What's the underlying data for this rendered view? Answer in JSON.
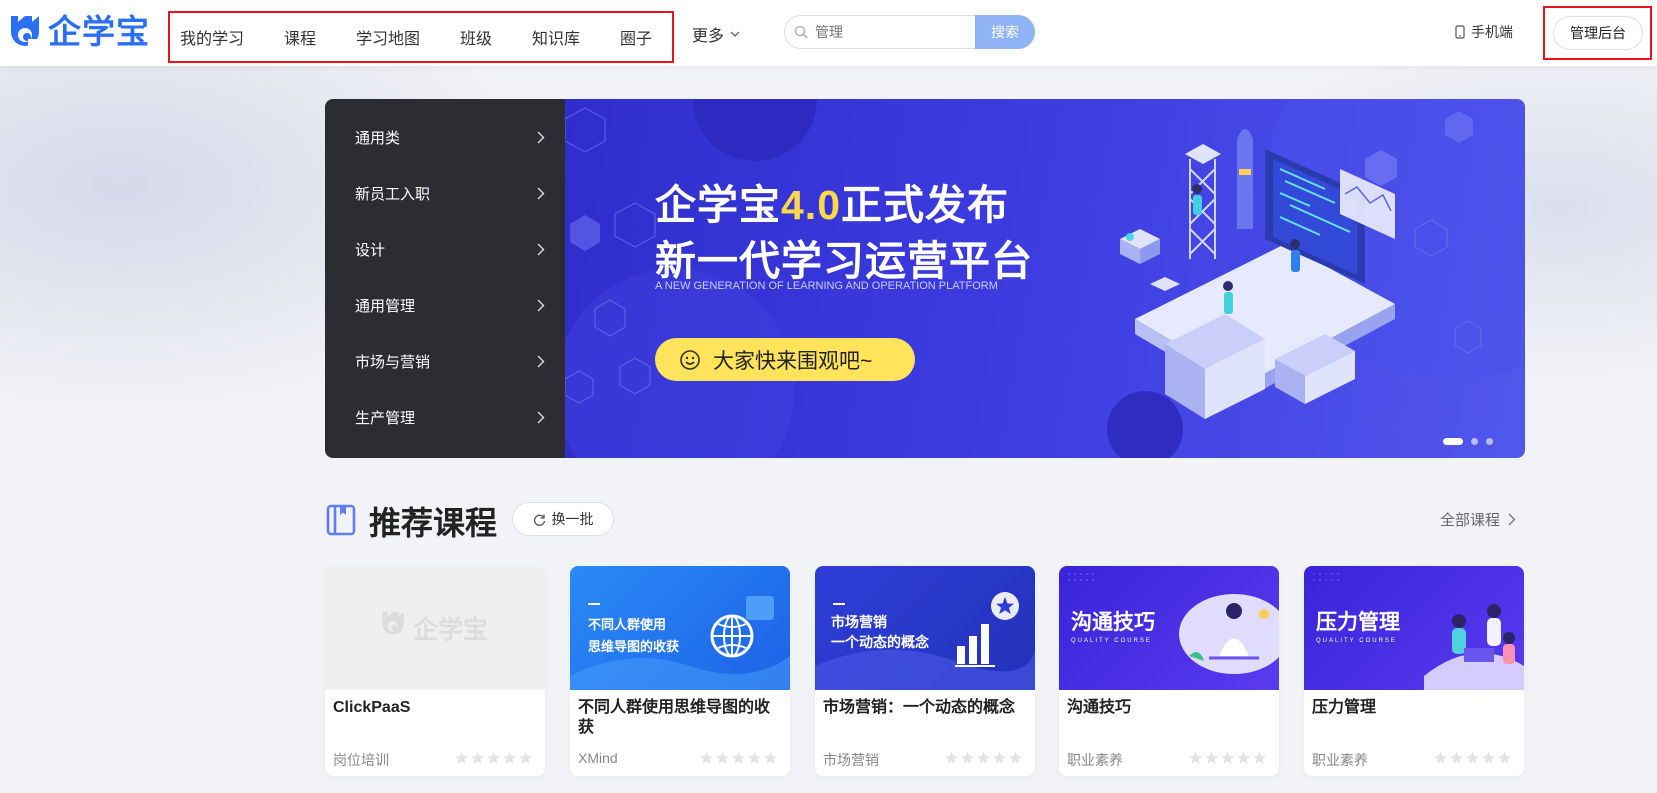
{
  "brand": {
    "name": "企学宝",
    "color": "#2b6ff2"
  },
  "nav": {
    "items": [
      "我的学习",
      "课程",
      "学习地图",
      "班级",
      "知识库",
      "圈子"
    ],
    "more": "更多"
  },
  "search": {
    "placeholder": "管理",
    "button": "搜索"
  },
  "header_right": {
    "mobile": "手机端",
    "admin": "管理后台"
  },
  "categories": [
    "通用类",
    "新员工入职",
    "设计",
    "通用管理",
    "市场与营销",
    "生产管理"
  ],
  "banner": {
    "title_prefix": "企学宝",
    "title_highlight": "4.0",
    "title_suffix": "正式发布",
    "title_line2": "新一代学习运营平台",
    "subtitle": "A NEW GENERATION OF LEARNING AND OPERATION PLATFORM",
    "cta": "大家快来围观吧~",
    "slides": 3,
    "active_slide": 1
  },
  "recommended": {
    "title": "推荐课程",
    "refresh": "换一批",
    "all": "全部课程",
    "cards": [
      {
        "title": "ClickPaaS",
        "category": "岗位培训",
        "cover_text": "企学宝"
      },
      {
        "title": "不同人群使用思维导图的收获",
        "category": "XMind",
        "cover_line1": "不同人群使用",
        "cover_line2": "思维导图的收获"
      },
      {
        "title": "市场营销：一个动态的概念",
        "category": "市场营销",
        "cover_line1": "市场营销",
        "cover_line2": "一个动态的概念"
      },
      {
        "title": "沟通技巧",
        "category": "职业素养",
        "cover_line1": "沟通技巧",
        "cover_sub": "QUALITY COURSE"
      },
      {
        "title": "压力管理",
        "category": "职业素养",
        "cover_line1": "压力管理",
        "cover_sub": "QUALITY COURSE"
      }
    ]
  }
}
